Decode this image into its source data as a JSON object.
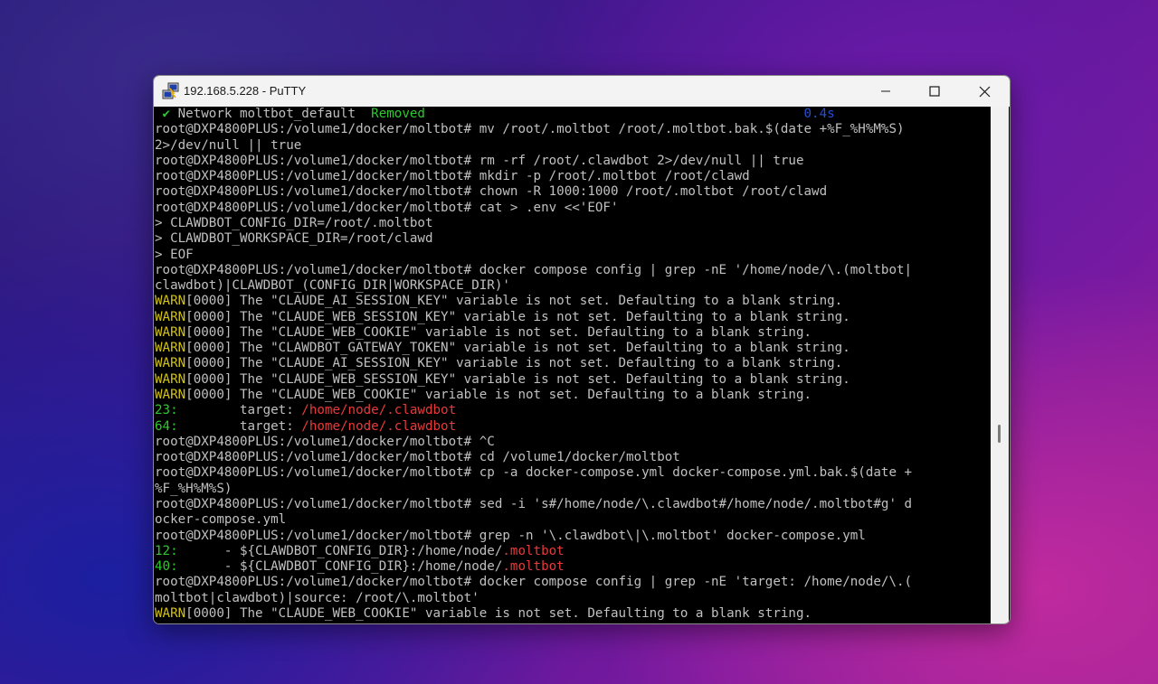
{
  "window": {
    "title": "192.168.5.228 - PuTTY"
  },
  "terminal": {
    "lines": [
      [
        {
          "t": " ✔ ",
          "c": "c-green"
        },
        {
          "t": "Network moltbot_default  "
        },
        {
          "t": "Removed",
          "c": "c-green"
        },
        {
          "t": "                                                 "
        },
        {
          "t": "0.4s",
          "c": "c-blue"
        }
      ],
      [
        {
          "t": "root@DXP4800PLUS:/volume1/docker/moltbot# mv /root/.moltbot /root/.moltbot.bak.$(date +%F_%H%M%S)"
        }
      ],
      [
        {
          "t": "2>/dev/null || true"
        }
      ],
      [
        {
          "t": "root@DXP4800PLUS:/volume1/docker/moltbot# rm -rf /root/.clawdbot 2>/dev/null || true"
        }
      ],
      [
        {
          "t": "root@DXP4800PLUS:/volume1/docker/moltbot# mkdir -p /root/.moltbot /root/clawd"
        }
      ],
      [
        {
          "t": "root@DXP4800PLUS:/volume1/docker/moltbot# chown -R 1000:1000 /root/.moltbot /root/clawd"
        }
      ],
      [
        {
          "t": "root@DXP4800PLUS:/volume1/docker/moltbot# cat > .env <<'EOF'"
        }
      ],
      [
        {
          "t": "> CLAWDBOT_CONFIG_DIR=/root/.moltbot"
        }
      ],
      [
        {
          "t": "> CLAWDBOT_WORKSPACE_DIR=/root/clawd"
        }
      ],
      [
        {
          "t": "> EOF"
        }
      ],
      [
        {
          "t": "root@DXP4800PLUS:/volume1/docker/moltbot# docker compose config | grep -nE '/home/node/\\.(moltbot|"
        }
      ],
      [
        {
          "t": "clawdbot)|CLAWDBOT_(CONFIG_DIR|WORKSPACE_DIR)'"
        }
      ],
      [
        {
          "t": "WARN",
          "c": "c-yellow"
        },
        {
          "t": "[0000] The \"CLAUDE_AI_SESSION_KEY\" variable is not set. Defaulting to a blank string."
        }
      ],
      [
        {
          "t": "WARN",
          "c": "c-yellow"
        },
        {
          "t": "[0000] The \"CLAUDE_WEB_SESSION_KEY\" variable is not set. Defaulting to a blank string."
        }
      ],
      [
        {
          "t": "WARN",
          "c": "c-yellow"
        },
        {
          "t": "[0000] The \"CLAUDE_WEB_COOKIE\" variable is not set. Defaulting to a blank string."
        }
      ],
      [
        {
          "t": "WARN",
          "c": "c-yellow"
        },
        {
          "t": "[0000] The \"CLAWDBOT_GATEWAY_TOKEN\" variable is not set. Defaulting to a blank string."
        }
      ],
      [
        {
          "t": "WARN",
          "c": "c-yellow"
        },
        {
          "t": "[0000] The \"CLAUDE_AI_SESSION_KEY\" variable is not set. Defaulting to a blank string."
        }
      ],
      [
        {
          "t": "WARN",
          "c": "c-yellow"
        },
        {
          "t": "[0000] The \"CLAUDE_WEB_SESSION_KEY\" variable is not set. Defaulting to a blank string."
        }
      ],
      [
        {
          "t": "WARN",
          "c": "c-yellow"
        },
        {
          "t": "[0000] The \"CLAUDE_WEB_COOKIE\" variable is not set. Defaulting to a blank string."
        }
      ],
      [
        {
          "t": "23:",
          "c": "c-green"
        },
        {
          "t": "        target: "
        },
        {
          "t": "/home/node/.clawdbot",
          "c": "c-red"
        }
      ],
      [
        {
          "t": "64:",
          "c": "c-green"
        },
        {
          "t": "        target: "
        },
        {
          "t": "/home/node/.clawdbot",
          "c": "c-red"
        }
      ],
      [
        {
          "t": "root@DXP4800PLUS:/volume1/docker/moltbot# ^C"
        }
      ],
      [
        {
          "t": "root@DXP4800PLUS:/volume1/docker/moltbot# cd /volume1/docker/moltbot"
        }
      ],
      [
        {
          "t": "root@DXP4800PLUS:/volume1/docker/moltbot# cp -a docker-compose.yml docker-compose.yml.bak.$(date +"
        }
      ],
      [
        {
          "t": "%F_%H%M%S)"
        }
      ],
      [
        {
          "t": "root@DXP4800PLUS:/volume1/docker/moltbot# sed -i 's#/home/node/\\.clawdbot#/home/node/.moltbot#g' d"
        }
      ],
      [
        {
          "t": "ocker-compose.yml"
        }
      ],
      [
        {
          "t": "root@DXP4800PLUS:/volume1/docker/moltbot# grep -n '\\.clawdbot\\|\\.moltbot' docker-compose.yml"
        }
      ],
      [
        {
          "t": "12:",
          "c": "c-green"
        },
        {
          "t": "      - ${CLAWDBOT_CONFIG_DIR}:/home/node/"
        },
        {
          "t": ".moltbot",
          "c": "c-red"
        }
      ],
      [
        {
          "t": "40:",
          "c": "c-green"
        },
        {
          "t": "      - ${CLAWDBOT_CONFIG_DIR}:/home/node/"
        },
        {
          "t": ".moltbot",
          "c": "c-red"
        }
      ],
      [
        {
          "t": "root@DXP4800PLUS:/volume1/docker/moltbot# docker compose config | grep -nE 'target: /home/node/\\.("
        }
      ],
      [
        {
          "t": "moltbot|clawdbot)|source: /root/\\.moltbot'"
        }
      ],
      [
        {
          "t": "WARN",
          "c": "c-yellow"
        },
        {
          "t": "[0000] The \"CLAUDE_WEB_COOKIE\" variable is not set. Defaulting to a blank string."
        }
      ]
    ]
  },
  "icons": {
    "app": "putty-icon",
    "minimize": "minimize-icon",
    "maximize": "maximize-icon",
    "close": "close-icon"
  },
  "colors": {
    "prompt_text": "#c0c0c0",
    "warn": "#d2c219",
    "ok_green": "#2ec82e",
    "path_red": "#e83a3a",
    "timing_blue": "#2a4fd0"
  }
}
